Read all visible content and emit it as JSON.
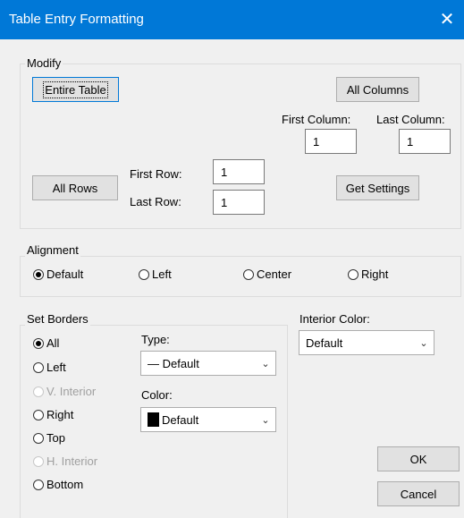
{
  "window": {
    "title": "Table Entry Formatting",
    "close_glyph": "✕"
  },
  "modify": {
    "group_label": "Modify",
    "entire_table_label": "Entire Table",
    "all_columns_label": "All Columns",
    "first_column_label": "First Column:",
    "last_column_label": "Last Column:",
    "first_column_value": "1",
    "last_column_value": "1",
    "all_rows_label": "All Rows",
    "first_row_label": "First Row:",
    "last_row_label": "Last Row:",
    "first_row_value": "1",
    "last_row_value": "1",
    "get_settings_label": "Get Settings"
  },
  "alignment": {
    "group_label": "Alignment",
    "options": [
      {
        "label": "Default",
        "selected": true
      },
      {
        "label": "Left",
        "selected": false
      },
      {
        "label": "Center",
        "selected": false
      },
      {
        "label": "Right",
        "selected": false
      }
    ]
  },
  "borders": {
    "group_label": "Set Borders",
    "options": [
      {
        "label": "All",
        "selected": true,
        "enabled": true
      },
      {
        "label": "Left",
        "selected": false,
        "enabled": true
      },
      {
        "label": "V. Interior",
        "selected": false,
        "enabled": false
      },
      {
        "label": "Right",
        "selected": false,
        "enabled": true
      },
      {
        "label": "Top",
        "selected": false,
        "enabled": true
      },
      {
        "label": "H. Interior",
        "selected": false,
        "enabled": false
      },
      {
        "label": "Bottom",
        "selected": false,
        "enabled": true
      }
    ],
    "type_label": "Type:",
    "type_value": "— Default",
    "color_label": "Color:",
    "color_value": "Default",
    "color_swatch": "#000000"
  },
  "interior": {
    "label": "Interior Color:",
    "value": "Default"
  },
  "footer": {
    "ok_label": "OK",
    "cancel_label": "Cancel"
  },
  "colors": {
    "titlebar": "#0078d7",
    "dialog_bg": "#f0f0f0",
    "button_bg": "#e1e1e1"
  }
}
